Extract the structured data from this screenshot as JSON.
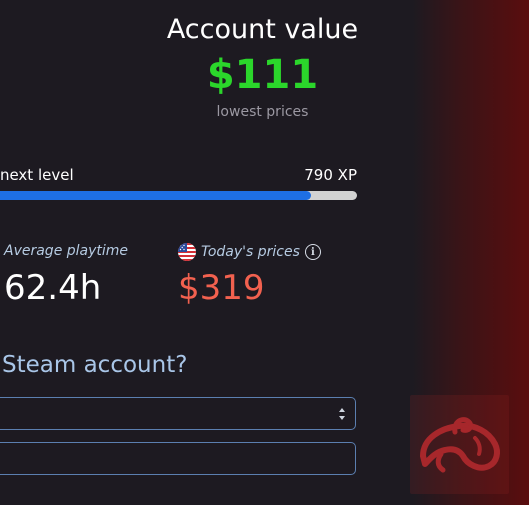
{
  "account": {
    "title": "Account value",
    "value": "$111",
    "subtitle": "lowest prices"
  },
  "level": {
    "label": "o next level",
    "xp": "790 XP",
    "progress": 0.87
  },
  "stats": {
    "playtime_label": "Average playtime",
    "playtime_value": "62.4h",
    "prices_label": "Today's prices",
    "prices_value": "$319"
  },
  "form": {
    "question": "Steam account?"
  },
  "icons": {
    "flag": "us-flag-icon",
    "info": "info-icon",
    "select": "select-arrows-icon",
    "logo": "brand-logo-icon"
  },
  "colors": {
    "value_green": "#2bd62b",
    "price_red": "#f2614f",
    "progress_blue": "#1e6fe4",
    "label_blue": "#b6cbe2"
  }
}
